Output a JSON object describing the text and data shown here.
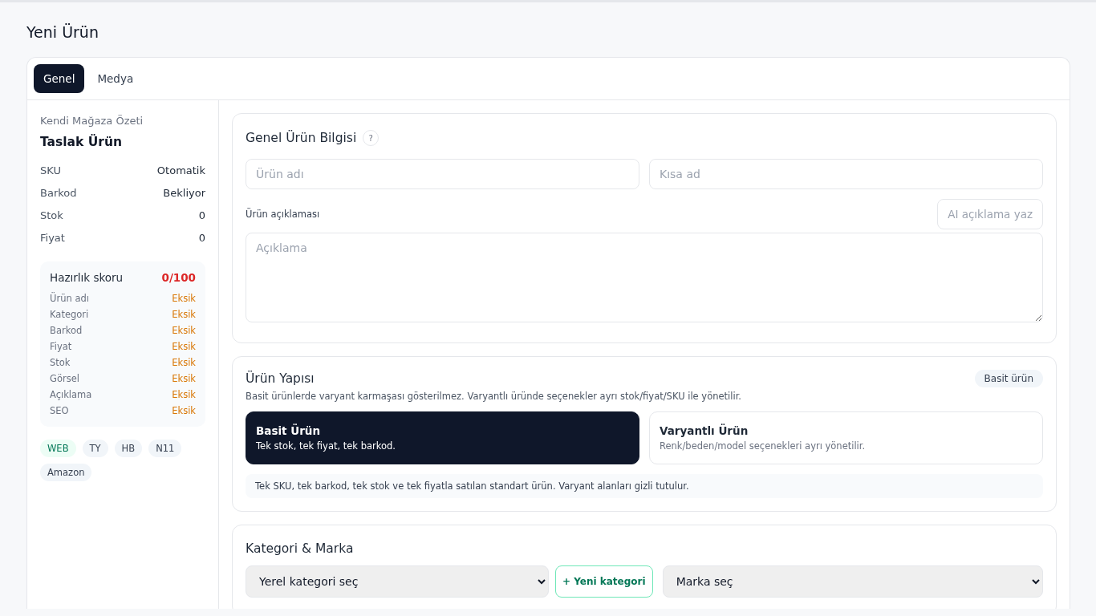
{
  "page": {
    "title": "Yeni Ürün"
  },
  "tabs": [
    {
      "label": "Genel",
      "selected": true
    },
    {
      "label": "Medya",
      "selected": false
    }
  ],
  "summary": {
    "heading": "Kendi Mağaza Özeti",
    "name": "Taslak Ürün",
    "facts": [
      {
        "label": "SKU",
        "value": "Otomatik"
      },
      {
        "label": "Barkod",
        "value": "Bekliyor"
      },
      {
        "label": "Stok",
        "value": "0"
      },
      {
        "label": "Fiyat",
        "value": "0"
      }
    ],
    "readiness": {
      "label": "Hazırlık skoru",
      "score": "0/100",
      "checks": [
        {
          "label": "Ürün adı",
          "status": "Eksik"
        },
        {
          "label": "Kategori",
          "status": "Eksik"
        },
        {
          "label": "Barkod",
          "status": "Eksik"
        },
        {
          "label": "Fiyat",
          "status": "Eksik"
        },
        {
          "label": "Stok",
          "status": "Eksik"
        },
        {
          "label": "Görsel",
          "status": "Eksik"
        },
        {
          "label": "Açıklama",
          "status": "Eksik"
        },
        {
          "label": "SEO",
          "status": "Eksik"
        }
      ]
    },
    "channels": [
      {
        "label": "WEB",
        "active": true
      },
      {
        "label": "TY",
        "active": false
      },
      {
        "label": "HB",
        "active": false
      },
      {
        "label": "N11",
        "active": false
      },
      {
        "label": "Amazon",
        "active": false
      }
    ]
  },
  "general": {
    "title": "Genel Ürün Bilgisi",
    "help": "?",
    "name_field": {
      "placeholder": "Ürün adı"
    },
    "short_field": {
      "placeholder": "Kısa ad"
    },
    "description_label": "Ürün açıklaması",
    "ai_button": "AI açıklama yaz",
    "description_field": {
      "placeholder": "Açıklama"
    }
  },
  "structure": {
    "title": "Ürün Yapısı",
    "badge": "Basit ürün",
    "hint": "Basit ürünlerde varyant karmaşası gösterilmez. Varyantlı üründe seçenekler ayrı stok/fiyat/SKU ile yönetilir.",
    "options": [
      {
        "title": "Basit Ürün",
        "text": "Tek stok, tek fiyat, tek barkod.",
        "selected": true
      },
      {
        "title": "Varyantlı Ürün",
        "text": "Renk/beden/model seçenekleri ayrı yönetilir.",
        "selected": false
      }
    ],
    "note": "Tek SKU, tek barkod, tek stok ve tek fiyatla satılan standart ürün. Varyant alanları gizli tutulur."
  },
  "category": {
    "title": "Kategori & Marka",
    "category_select": "Yerel kategori seç",
    "new_button": "+ Yeni kategori",
    "brand_select": "Marka seç"
  }
}
